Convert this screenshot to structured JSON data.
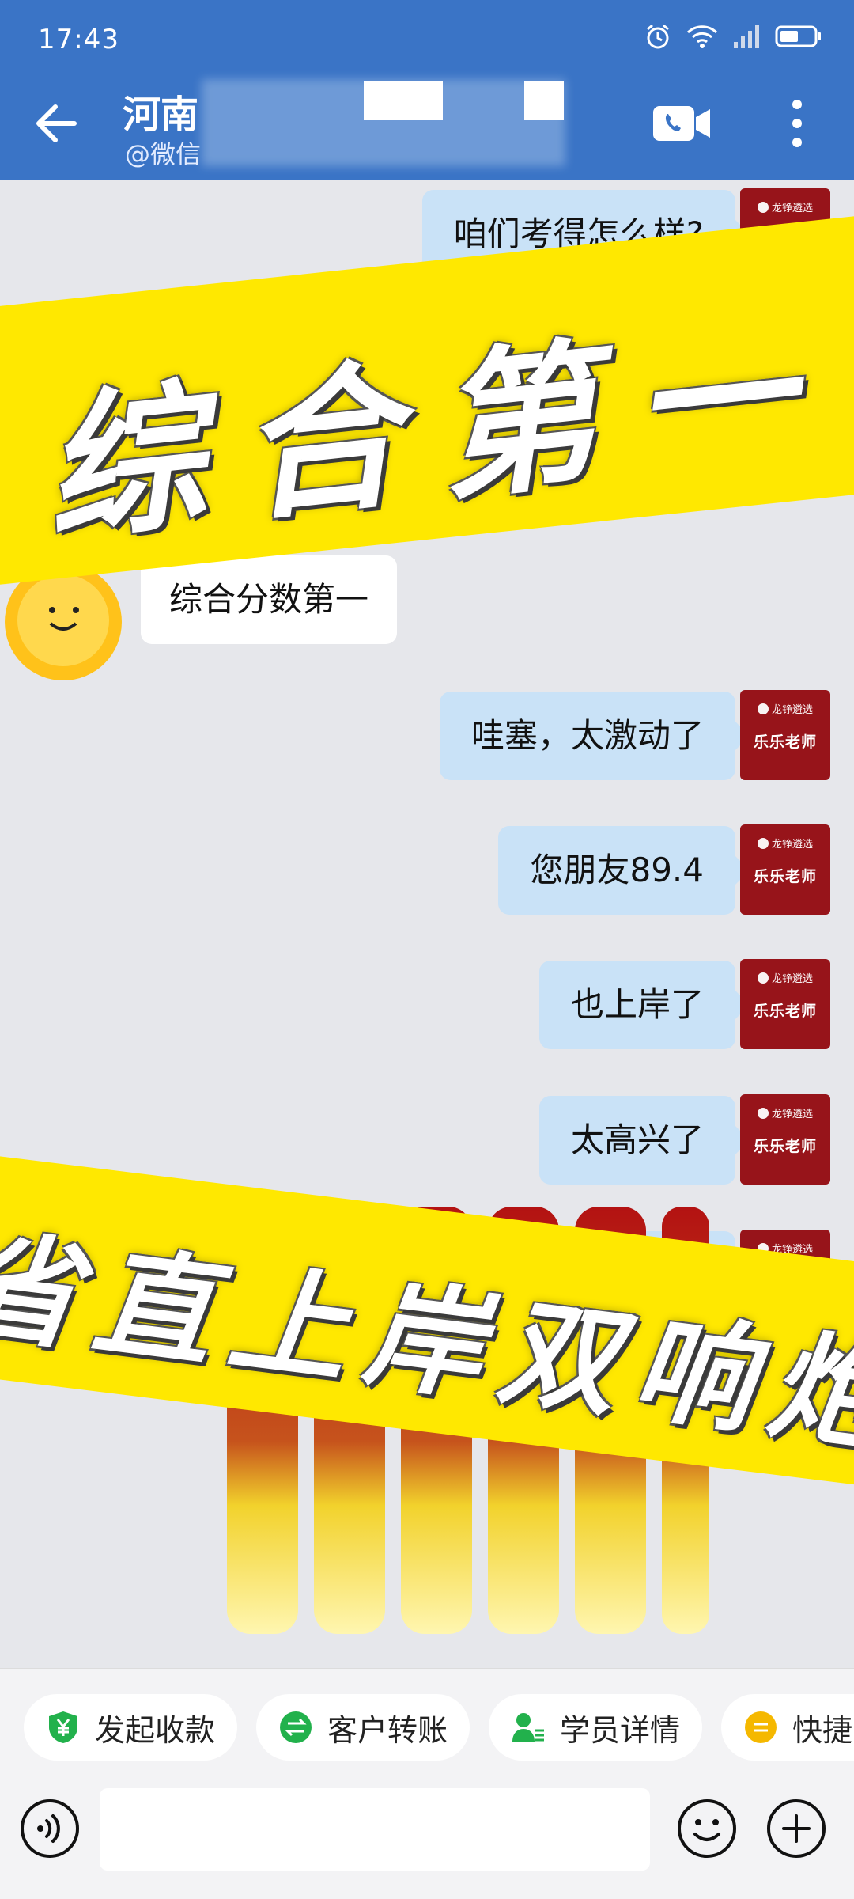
{
  "status": {
    "time": "17:43"
  },
  "header": {
    "title": "河南",
    "subtitle": "@微信"
  },
  "messages": [
    {
      "dir": "out",
      "text": "咱们考得怎么样?"
    },
    {
      "dir": "in",
      "text": "综合分数第一"
    },
    {
      "dir": "out",
      "text": "哇塞，太激动了"
    },
    {
      "dir": "out",
      "text": "您朋友89.4"
    },
    {
      "dir": "out",
      "text": "也上岸了"
    },
    {
      "dir": "out",
      "text": "太高兴了"
    }
  ],
  "teacher_avatar": {
    "brand": "龙铮遴选",
    "name": "乐乐老师"
  },
  "banners": {
    "top": "综合第一",
    "bottom": "省直上岸双响炮"
  },
  "quick_actions": [
    {
      "label": "发起收款",
      "icon": "yuan-shield-icon",
      "color": "#22b14c"
    },
    {
      "label": "客户转账",
      "icon": "transfer-icon",
      "color": "#22b14c"
    },
    {
      "label": "学员详情",
      "icon": "user-detail-icon",
      "color": "#22b14c"
    },
    {
      "label": "快捷",
      "icon": "quick-reply-icon",
      "color": "#f5b800"
    }
  ],
  "colors": {
    "header": "#3a74c6",
    "bubble_out": "#c9e2f7",
    "banner": "#ffe800",
    "avatar": "#97141a"
  }
}
